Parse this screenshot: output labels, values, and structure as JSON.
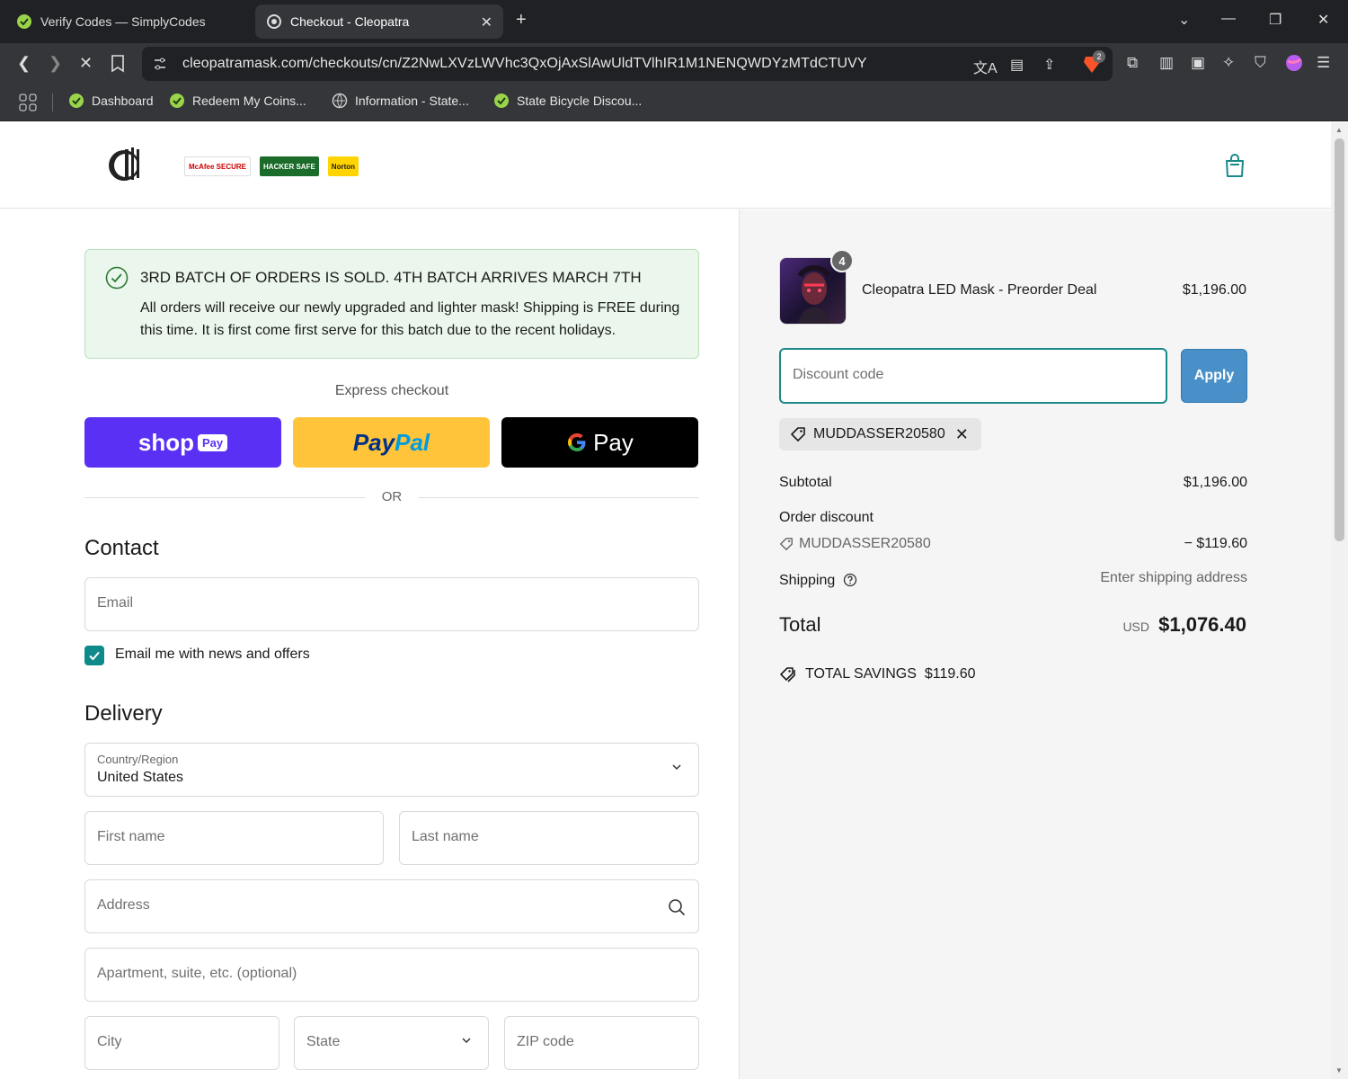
{
  "browser": {
    "tabs": [
      {
        "title": "Verify Codes — SimplyCodes",
        "active": false
      },
      {
        "title": "Checkout - Cleopatra",
        "active": true
      }
    ],
    "url": "cleopatramask.com/checkouts/cn/Z2NwLXVzLWVhc3QxOjAxSlAwUldTVlhIR1M1NENQWDYzMTdCTUVY",
    "shield_count": "2",
    "bookmarks": [
      "Dashboard",
      "Redeem My Coins...",
      "Information - State...",
      "State Bicycle Discou..."
    ]
  },
  "header": {
    "badges": [
      "McAfee SECURE",
      "HACKER SAFE",
      "Norton"
    ]
  },
  "notice": {
    "title": "3RD BATCH OF ORDERS IS SOLD. 4TH BATCH ARRIVES MARCH 7TH",
    "body": "All orders will receive our newly upgraded and lighter mask! Shipping is FREE during this time. It is first come first serve for this batch due to the recent holidays."
  },
  "express": {
    "label": "Express checkout",
    "shop": "shop",
    "shop_tag": "Pay",
    "paypal_a": "Pay",
    "paypal_b": "Pal",
    "gpay": "Pay",
    "or": "OR"
  },
  "contact": {
    "title": "Contact",
    "email_placeholder": "Email",
    "newsletter_label": "Email me with news and offers",
    "newsletter_checked": true
  },
  "delivery": {
    "title": "Delivery",
    "country_label": "Country/Region",
    "country_value": "United States",
    "first_name": "First name",
    "last_name": "Last name",
    "address": "Address",
    "apartment": "Apartment, suite, etc. (optional)",
    "city": "City",
    "state": "State",
    "zip": "ZIP code"
  },
  "summary": {
    "product": {
      "name": "Cleopatra LED Mask - Preorder Deal",
      "price": "$1,196.00",
      "quantity": "4"
    },
    "discount_placeholder": "Discount code",
    "apply": "Apply",
    "applied_code": "MUDDASSER20580",
    "subtotal_label": "Subtotal",
    "subtotal": "$1,196.00",
    "order_discount_label": "Order discount",
    "discount_code": "MUDDASSER20580",
    "discount_amount": "− $119.60",
    "shipping_label": "Shipping",
    "shipping_value": "Enter shipping address",
    "total_label": "Total",
    "currency": "USD",
    "total": "$1,076.40",
    "savings_label": "TOTAL SAVINGS",
    "savings_value": "$119.60"
  },
  "colors": {
    "accent": "#1b8a8a",
    "apply": "#4a90c8",
    "shop_pay": "#5a31f4",
    "paypal": "#ffc439"
  }
}
